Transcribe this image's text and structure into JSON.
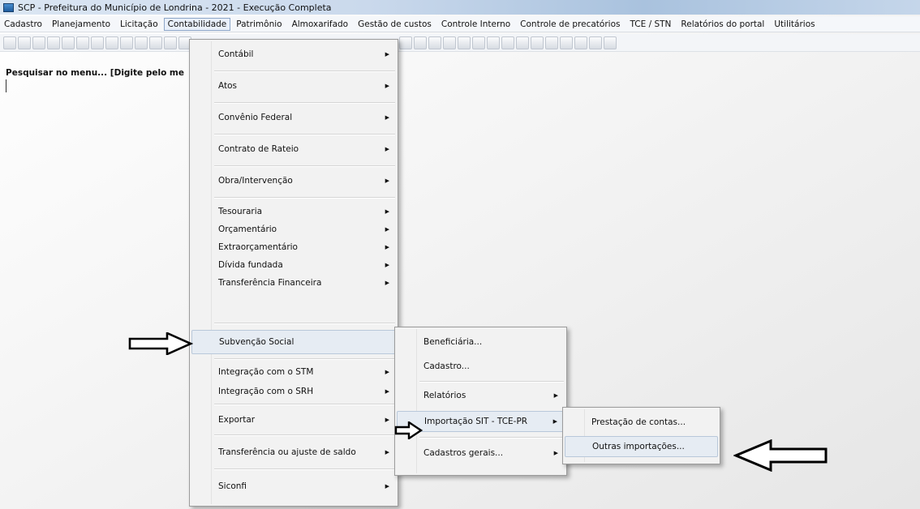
{
  "window": {
    "title": "SCP - Prefeitura do Município de Londrina - 2021 - Execução Completa"
  },
  "menubar": [
    {
      "label": "Cadastro"
    },
    {
      "label": "Planejamento"
    },
    {
      "label": "Licitação"
    },
    {
      "label": "Contabilidade",
      "active": true
    },
    {
      "label": "Patrimônio"
    },
    {
      "label": "Almoxarifado"
    },
    {
      "label": "Gestão de custos"
    },
    {
      "label": "Controle Interno"
    },
    {
      "label": "Controle de precatórios"
    },
    {
      "label": "TCE / STN"
    },
    {
      "label": "Relatórios do portal"
    },
    {
      "label": "Utilitários"
    }
  ],
  "search": {
    "label": "Pesquisar no menu... [Digite pelo me"
  },
  "contabilidade_menu": [
    {
      "label": "Contábil",
      "submenu": true
    },
    {
      "label": "Atos",
      "submenu": true
    },
    {
      "label": "Convênio Federal",
      "submenu": true
    },
    {
      "label": "Contrato de Rateio",
      "submenu": true
    },
    {
      "label": "Obra/Intervenção",
      "submenu": true
    },
    {
      "label": "Tesouraria",
      "submenu": true
    },
    {
      "label": "Orçamentário",
      "submenu": true
    },
    {
      "label": "Extraorçamentário",
      "submenu": true
    },
    {
      "label": "Dívida fundada",
      "submenu": true
    },
    {
      "label": "Transferência Financeira",
      "submenu": true
    },
    {
      "label": "Subvenção Social",
      "submenu": false,
      "highlighted": true
    },
    {
      "label": "Integração com o STM",
      "submenu": true
    },
    {
      "label": "Integração com o SRH",
      "submenu": true
    },
    {
      "label": "Exportar",
      "submenu": true
    },
    {
      "label": "Transferência ou ajuste de saldo",
      "submenu": true
    },
    {
      "label": "Siconfi",
      "submenu": true
    }
  ],
  "subvencao_menu": [
    {
      "label": "Beneficiária...",
      "submenu": false
    },
    {
      "label": "Cadastro...",
      "submenu": false
    },
    {
      "label": "Relatórios",
      "submenu": true
    },
    {
      "label": "Importação SIT - TCE-PR",
      "submenu": true,
      "highlighted": true
    },
    {
      "label": "Cadastros gerais...",
      "submenu": true
    }
  ],
  "importacao_menu": [
    {
      "label": "Prestação de contas..."
    },
    {
      "label": "Outras importações...",
      "highlighted": true
    }
  ],
  "icons": {
    "submenu_arrow": "▶"
  }
}
